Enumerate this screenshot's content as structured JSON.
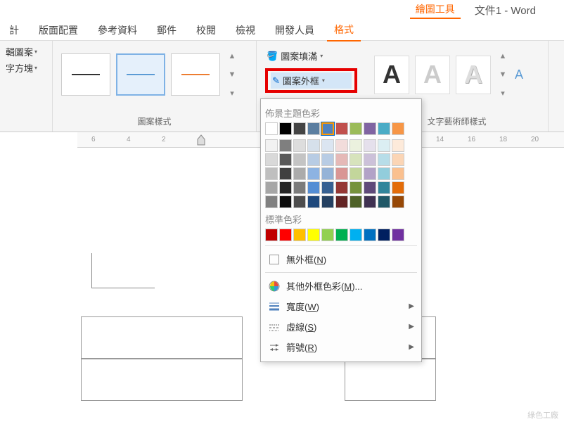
{
  "header": {
    "drawing_tools": "繪圖工具",
    "doc_title": "文件1 - Word"
  },
  "tabs": [
    "計",
    "版面配置",
    "參考資料",
    "郵件",
    "校閱",
    "檢視",
    "開發人員",
    "格式"
  ],
  "active_tab": "格式",
  "ribbon": {
    "edit_pattern": "輯圖案",
    "text_box": "字方塊",
    "shape_styles_label": "圖案樣式",
    "fill_label": "圖案填滿",
    "outline_label": "圖案外框",
    "text_art_label": "文字藝術師樣式"
  },
  "ruler_marks": [
    6,
    4,
    2,
    14,
    16,
    18,
    20
  ],
  "popup": {
    "theme_heading": "佈景主題色彩",
    "standard_heading": "標準色彩",
    "no_outline": "無外框(",
    "no_outline_key": "N",
    "more_colors": "其他外框色彩(",
    "more_colors_key": "M",
    "more_colors_suffix": ")...",
    "width": "寬度(",
    "width_key": "W",
    "dashes": "虛線(",
    "dashes_key": "S",
    "arrows": "箭號(",
    "arrows_key": "R",
    "theme_row1": [
      "#ffffff",
      "#000000",
      "#444444",
      "#5b7ea0",
      "#4f81bd",
      "#c0504d",
      "#9bbb59",
      "#8064a2",
      "#4bacc6",
      "#f79646"
    ],
    "theme_shades": [
      [
        "#f2f2f2",
        "#7f7f7f",
        "#dddddd",
        "#d6e0eb",
        "#dbe5f1",
        "#f2dcdb",
        "#ebf1de",
        "#e5e0ec",
        "#dbeef3",
        "#fdeada"
      ],
      [
        "#d9d9d9",
        "#595959",
        "#c4c4c4",
        "#b8cce4",
        "#b8cce4",
        "#e5b9b7",
        "#d7e3bc",
        "#ccc1d9",
        "#b7dde8",
        "#fbd5b5"
      ],
      [
        "#bfbfbf",
        "#404040",
        "#ababab",
        "#8db3e2",
        "#95b3d7",
        "#d99694",
        "#c3d69b",
        "#b2a2c7",
        "#92cddc",
        "#fac08f"
      ],
      [
        "#a6a6a6",
        "#262626",
        "#7b7b7b",
        "#548dd4",
        "#366092",
        "#953734",
        "#76923c",
        "#5f497a",
        "#31859b",
        "#e36c09"
      ],
      [
        "#808080",
        "#0d0d0d",
        "#4d4d4d",
        "#1f497d",
        "#244061",
        "#632423",
        "#4f6228",
        "#3f3151",
        "#205867",
        "#974806"
      ]
    ],
    "standard_colors": [
      "#c00000",
      "#ff0000",
      "#ffc000",
      "#ffff00",
      "#92d050",
      "#00b050",
      "#00b0f0",
      "#0070c0",
      "#002060",
      "#7030a0"
    ]
  },
  "watermark": "綠色工廠"
}
